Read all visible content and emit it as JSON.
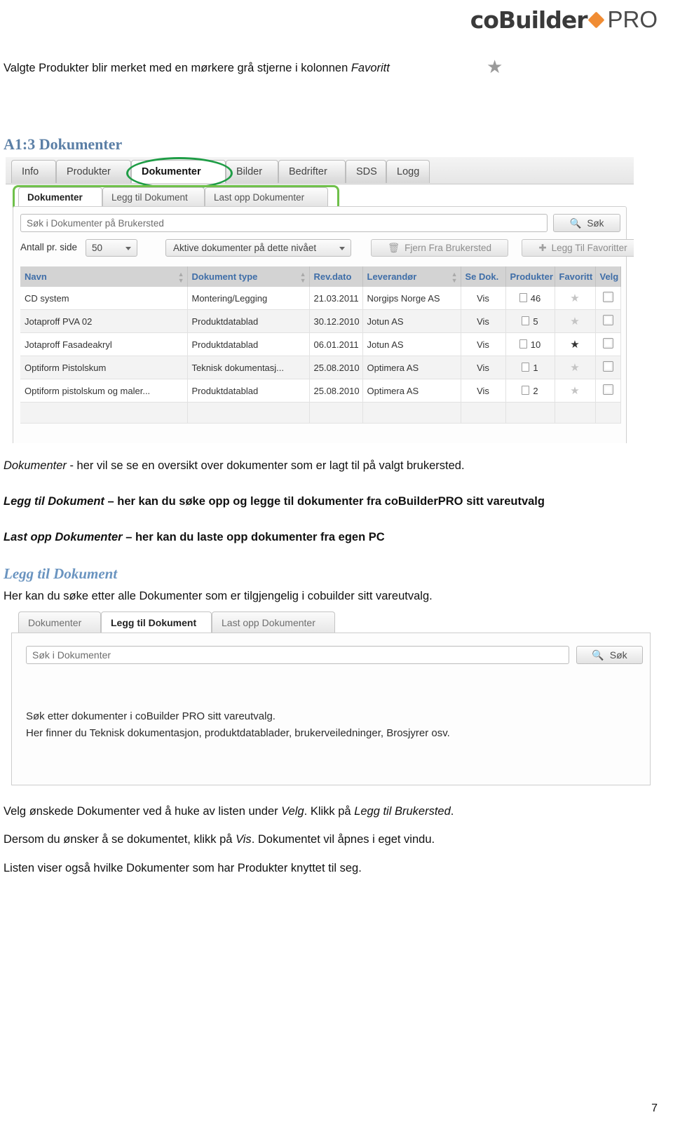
{
  "logo": {
    "left": "coBuilder",
    "right": "PRO",
    "accent": "#f08c33"
  },
  "intro": {
    "text_before": "Valgte Produkter blir merket med en mørkere grå stjerne i kolonnen ",
    "text_italic": "Favoritt",
    "star_icon": "star-icon"
  },
  "section": {
    "heading": "A1:3 Dokumenter",
    "heading_color": "#5b7fa6"
  },
  "screenshot1": {
    "main_tabs": [
      "Info",
      "Produkter",
      "Dokumenter",
      "Bilder",
      "Bedrifter",
      "SDS",
      "Logg"
    ],
    "active_main_tab": "Dokumenter",
    "annotation_color_ring": "#1f9d46",
    "annotation_color_rect": "#6fc04a",
    "sub_tabs": [
      "Dokumenter",
      "Legg til Dokument",
      "Last opp Dokumenter"
    ],
    "active_sub_tab": "Dokumenter",
    "search": {
      "placeholder": "Søk i Dokumenter på Brukersted",
      "button": "Søk",
      "icon": "search-icon"
    },
    "toolbar": {
      "per_page_label": "Antall pr. side",
      "per_page_value": "50",
      "filter_value": "Aktive dokumenter på dette nivået",
      "remove_button": "Fjern Fra Brukersted",
      "remove_icon": "trash-icon",
      "favorite_button": "Legg Til Favoritter",
      "favorite_icon": "plus-icon"
    },
    "table": {
      "columns": [
        "Navn",
        "Dokument type",
        "Rev.dato",
        "Leverandør",
        "Se Dok.",
        "Produkter",
        "Favoritt",
        "Velg"
      ],
      "rows": [
        {
          "navn": "CD system",
          "type": "Montering/Legging",
          "dato": "21.03.2011",
          "leverandor": "Norgips Norge AS",
          "se_dok": "Vis",
          "produkter": "46",
          "favoritt": "off",
          "velg": "unchecked"
        },
        {
          "navn": "Jotaproff PVA 02",
          "type": "Produktdatablad",
          "dato": "30.12.2010",
          "leverandor": "Jotun AS",
          "se_dok": "Vis",
          "produkter": "5",
          "favoritt": "off",
          "velg": "unchecked"
        },
        {
          "navn": "Jotaproff Fasadeakryl",
          "type": "Produktdatablad",
          "dato": "06.01.2011",
          "leverandor": "Jotun AS",
          "se_dok": "Vis",
          "produkter": "10",
          "favoritt": "on",
          "velg": "unchecked"
        },
        {
          "navn": "Optiform Pistolskum",
          "type": "Teknisk dokumentasj...",
          "dato": "25.08.2010",
          "leverandor": "Optimera AS",
          "se_dok": "Vis",
          "produkter": "1",
          "favoritt": "off",
          "velg": "unchecked"
        },
        {
          "navn": "Optiform pistolskum og maler...",
          "type": "Produktdatablad",
          "dato": "25.08.2010",
          "leverandor": "Optimera AS",
          "se_dok": "Vis",
          "produkter": "2",
          "favoritt": "off",
          "velg": "unchecked"
        }
      ]
    }
  },
  "body": {
    "p1_italic": "Dokumenter",
    "p1_rest": " - her vil se se en oversikt over dokumenter som er lagt til på valgt brukersted.",
    "p2_italic": "Legg til Dokument",
    "p2_rest": " – her kan du søke opp og legge til dokumenter fra coBuilderPRO sitt vareutvalg",
    "p3_italic": "Last opp Dokumenter",
    "p3_rest": " – her kan du laste opp dokumenter fra egen PC",
    "sub_heading": "Legg til Dokument",
    "p4": "Her kan du søke etter alle Dokumenter som er tilgjengelig i cobuilder sitt vareutvalg."
  },
  "screenshot2": {
    "tabs": [
      "Dokumenter",
      "Legg til Dokument",
      "Last opp Dokumenter"
    ],
    "active_tab": "Legg til Dokument",
    "search": {
      "placeholder": "Søk i Dokumenter",
      "button": "Søk",
      "icon": "search-icon"
    },
    "hint_line1": "Søk etter dokumenter i coBuilder PRO sitt vareutvalg.",
    "hint_line2": "Her finner du Teknisk dokumentasjon, produktdatablader, brukerveiledninger, Brosjyrer osv."
  },
  "closing": {
    "p5_a": "Velg ønskede Dokumenter ved å huke av listen under ",
    "p5_i1": "Velg",
    "p5_b": ". Klikk på ",
    "p5_i2": "Legg til Brukersted",
    "p5_c": ".",
    "p6_a": "Dersom du ønsker å se dokumentet, klikk på ",
    "p6_i1": "Vis",
    "p6_b": ". Dokumentet vil åpnes i eget vindu.",
    "p7": "Listen viser også hvilke Dokumenter som har Produkter knyttet til seg."
  },
  "footer": {
    "page_number": "7"
  }
}
